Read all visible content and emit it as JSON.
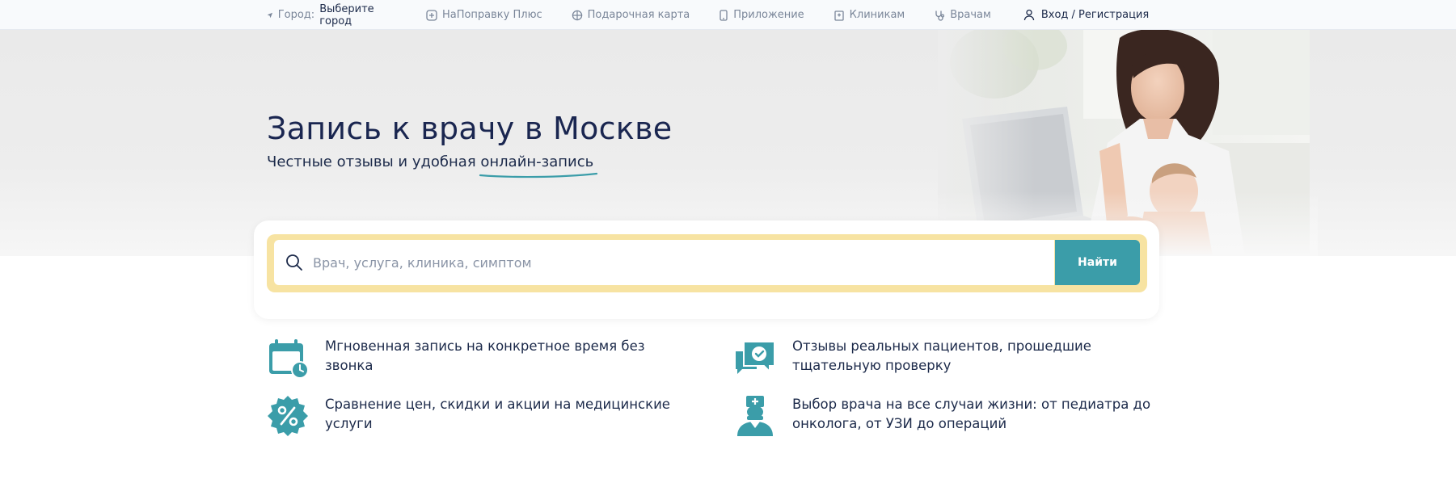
{
  "topbar": {
    "city_label": "Город:",
    "city_value": "Выберите город",
    "nav": [
      {
        "label": "НаПоправку Плюс",
        "icon": "plus-badge-icon"
      },
      {
        "label": "Подарочная карта",
        "icon": "gift-icon"
      },
      {
        "label": "Приложение",
        "icon": "phone-icon"
      },
      {
        "label": "Клиникам",
        "icon": "clinic-icon"
      },
      {
        "label": "Врачам",
        "icon": "stethoscope-icon"
      }
    ],
    "login": "Вход / Регистрация"
  },
  "hero": {
    "title": "Запись к врачу в Москве",
    "subtitle_prefix": "Честные отзывы и удобная ",
    "subtitle_accent": "онлайн-запись"
  },
  "search": {
    "placeholder": "Врач, услуга, клиника, симптом",
    "button": "Найти"
  },
  "features": [
    {
      "text": "Мгновенная запись на конкретное время без звонка",
      "icon": "calendar-clock-icon"
    },
    {
      "text": "Отзывы реальных пациентов, прошедшие тщательную проверку",
      "icon": "verified-chat-icon"
    },
    {
      "text": "Сравнение цен, скидки и акции на медицинские услуги",
      "icon": "percent-badge-icon"
    },
    {
      "text": "Выбор врача на все случаи жизни: от педиатра до онколога, от УЗИ до операций",
      "icon": "doctor-icon"
    }
  ],
  "colors": {
    "accent": "#3b9da9",
    "search_frame": "#f7e3a2",
    "title": "#1a2650"
  }
}
